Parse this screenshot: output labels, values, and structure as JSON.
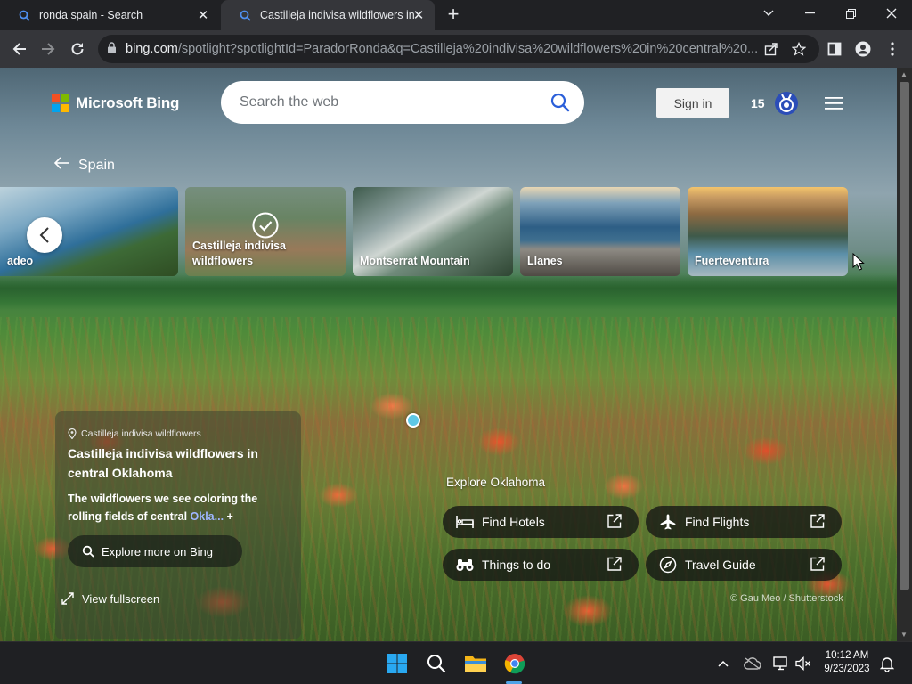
{
  "browser": {
    "tabs": [
      {
        "title": "ronda spain - Search",
        "active": false
      },
      {
        "title": "Castilleja indivisa wildflowers in c",
        "active": true
      }
    ],
    "url_host": "bing.com",
    "url_path": "/spotlight?spotlightId=ParadorRonda&q=Castilleja%20indivisa%20wildflowers%20in%20central%20..."
  },
  "header": {
    "logo_text": "Microsoft Bing",
    "search_placeholder": "Search the web",
    "sign_in": "Sign in",
    "points": "15"
  },
  "nav": {
    "back_label": "Spain"
  },
  "carousel": {
    "items": [
      {
        "label": "adeo"
      },
      {
        "label": "Castilleja indivisa wildflowers",
        "selected": true
      },
      {
        "label": "Montserrat Mountain"
      },
      {
        "label": "Llanes"
      },
      {
        "label": "Fuerteventura"
      }
    ]
  },
  "info": {
    "location": "Castilleja indivisa wildflowers",
    "title": "Castilleja indivisa wildflowers in central Oklahoma",
    "description": "The wildflowers we see coloring the rolling fields of central ",
    "description_more": "Okla...",
    "expand": "+",
    "explore_button": "Explore more on Bing",
    "fullscreen": "View fullscreen"
  },
  "explore": {
    "title": "Explore Oklahoma",
    "actions": [
      {
        "label": "Find Hotels",
        "icon": "bed-icon"
      },
      {
        "label": "Find Flights",
        "icon": "plane-icon"
      },
      {
        "label": "Things to do",
        "icon": "binoculars-icon"
      },
      {
        "label": "Travel Guide",
        "icon": "compass-icon"
      }
    ]
  },
  "credit": "© Gau Meo / Shutterstock",
  "taskbar": {
    "time": "10:12 AM",
    "date": "9/23/2023"
  },
  "colors": {
    "bing_blue": "#2b5fd9",
    "accent_cyan": "#5ec8e6",
    "chrome_dark": "#202124"
  }
}
